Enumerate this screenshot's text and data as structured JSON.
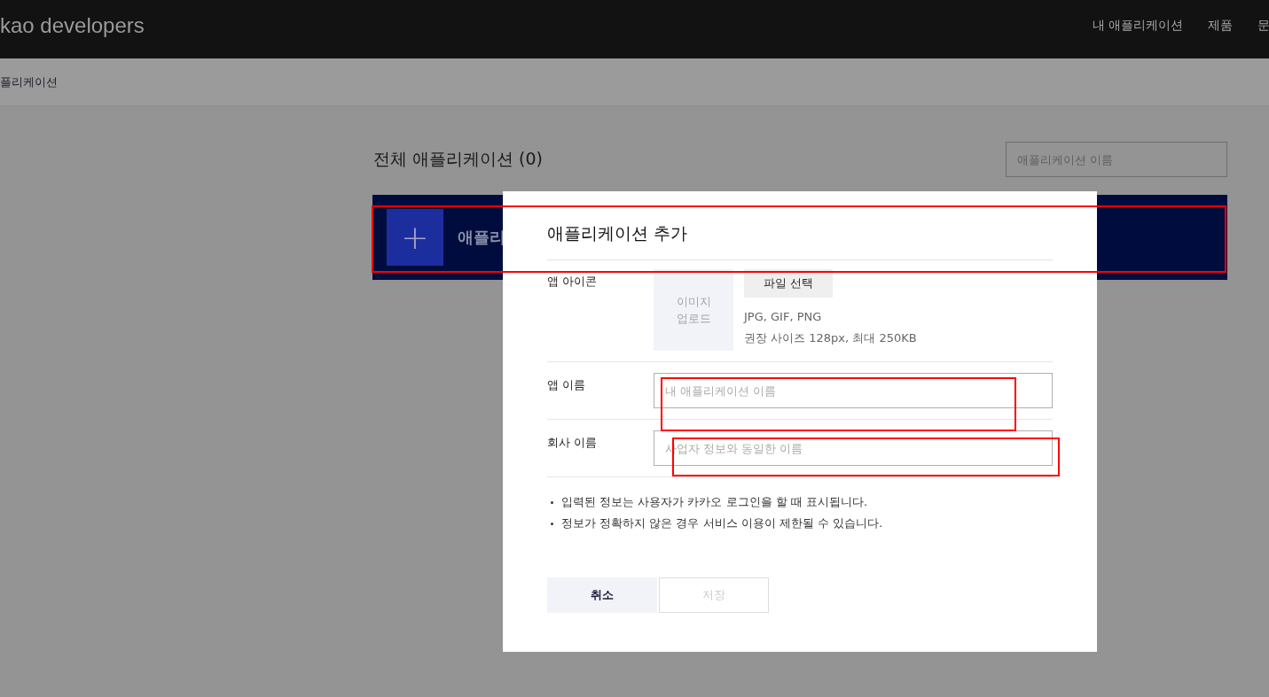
{
  "header": {
    "logo": "kao developers",
    "nav": [
      {
        "label": "내 애플리케이션"
      },
      {
        "label": "제품"
      },
      {
        "label": "문"
      }
    ]
  },
  "breadcrumb": "플리케이션",
  "content": {
    "title": "전체 애플리케이션 (0)",
    "search": {
      "placeholder": "애플리케이션 이름"
    },
    "create_bar": {
      "icon": "+",
      "label": "애플리"
    }
  },
  "modal": {
    "title": "애플리케이션 추가",
    "icon_row": {
      "label": "앱 아이콘",
      "upload_box": [
        "이미지",
        "업로드"
      ],
      "file_button": "파일 선택",
      "hints": [
        "JPG, GIF, PNG",
        "권장 사이즈 128px, 최대 250KB"
      ]
    },
    "fields": [
      {
        "label": "앱 이름",
        "placeholder": "내 애플리케이션 이름"
      },
      {
        "label": "회사 이름",
        "placeholder": "사업자 정보와 동일한 이름"
      }
    ],
    "notes": [
      "입력된 정보는 사용자가 카카오 로그인을 할 때 표시됩니다.",
      "정보가 정확하지 않은 경우 서비스 이용이 제한될 수 있습니다."
    ],
    "buttons": [
      {
        "label": "취소",
        "disabled": false
      },
      {
        "label": "저장",
        "disabled": true
      }
    ]
  },
  "annotations": [
    {
      "kind": "highlight"
    },
    {
      "kind": "highlight"
    },
    {
      "kind": "highlight"
    }
  ]
}
